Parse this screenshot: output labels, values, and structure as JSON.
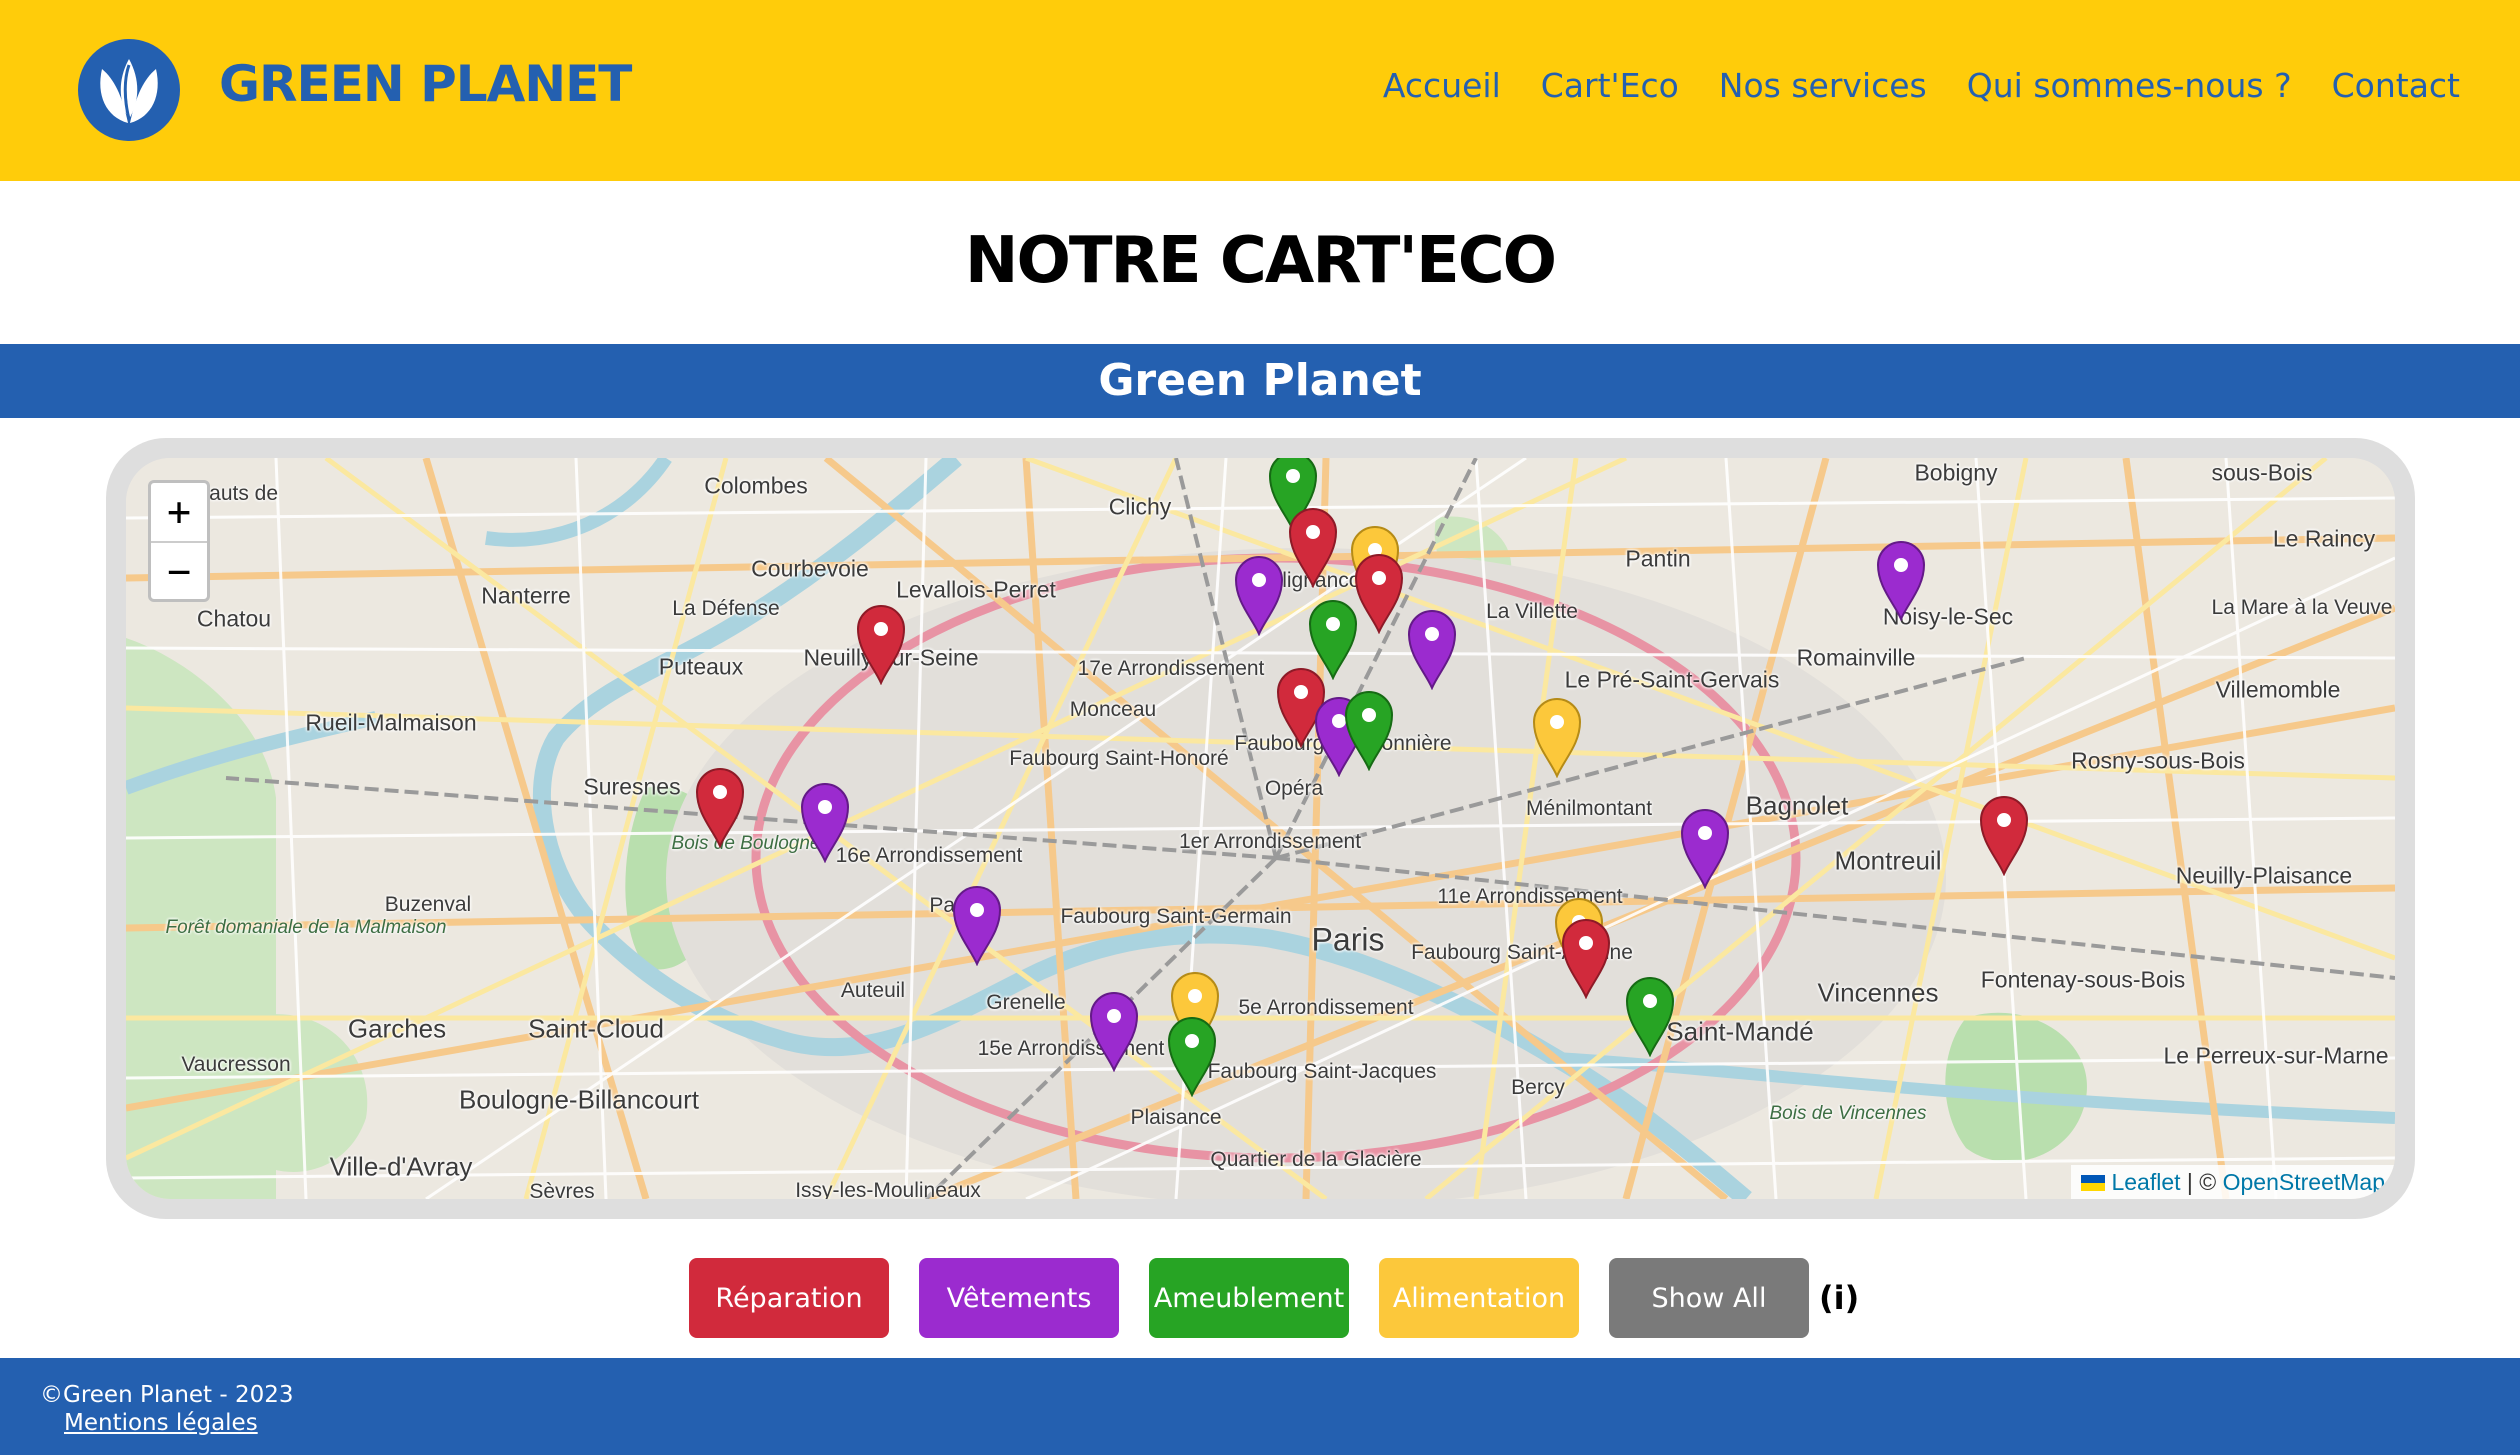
{
  "header": {
    "brand": "GREEN PLANET",
    "nav": [
      "Accueil",
      "Cart'Eco",
      "Nos services",
      "Qui sommes-nous ?",
      "Contact"
    ],
    "logo_icon": "leaf-logo-icon"
  },
  "page_title": "NOTRE CART'ECO",
  "band_title": "Green Planet",
  "map": {
    "zoom_in": "+",
    "zoom_out": "−",
    "attribution": {
      "leaflet": "Leaflet",
      "separator": " | © ",
      "osm": "OpenStreetMap"
    },
    "places": [
      "Hauts de",
      "Chatou",
      "Colombes",
      "Clichy",
      "Bobigny",
      "sous-Bois",
      "Le Raincy",
      "Nanterre",
      "Courbevoie",
      "La Défense",
      "Levallois-Perret",
      "Clignancourt",
      "Pantin",
      "La Villette",
      "Noisy-le-Sec",
      "La Mare à la Veuve",
      "Rueil-Malmaison",
      "Puteaux",
      "Neuilly-sur-Seine",
      "17e Arrondissement",
      "Monceau",
      "Le Pré-Saint-Gervais",
      "Romainville",
      "Villemomble",
      "Suresnes",
      "Faubourg Saint-Honoré",
      "Faubourg Poissonnière",
      "Opéra",
      "Ménilmontant",
      "Bagnolet",
      "Rosny-sous-Bois",
      "Bois de Boulogne",
      "16e Arrondissement",
      "1er Arrondissement",
      "Montreuil",
      "Neuilly-Plaisance",
      "Buzenval",
      "Forêt domaniale de la Malmaison",
      "Passy",
      "Faubourg Saint-Germain",
      "Paris",
      "11e Arrondissement",
      "Faubourg Saint-Antoine",
      "Fontenay-sous-Bois",
      "Garches",
      "Saint-Cloud",
      "Auteuil",
      "Grenelle",
      "15e Arrondissement",
      "5e Arrondissement",
      "Saint-Mandé",
      "Vincennes",
      "Le Perreux-sur-Marne",
      "Vaucresson",
      "Boulogne-Billancourt",
      "Faubourg Saint-Jacques",
      "Bercy",
      "Bois de Vincennes",
      "Ville-d'Avray",
      "Plaisance",
      "Quartier de la Glacière",
      "Sèvres",
      "Issy-les-Moulineaux"
    ],
    "marker_colors": {
      "reparation": "#D12A3C",
      "vetements": "#9B2BCF",
      "ameublement": "#27A424",
      "alimentation": "#FCC83B"
    },
    "markers": [
      {
        "category": "ameublement"
      },
      {
        "category": "reparation"
      },
      {
        "category": "alimentation"
      },
      {
        "category": "vetements"
      },
      {
        "category": "reparation"
      },
      {
        "category": "ameublement"
      },
      {
        "category": "vetements"
      },
      {
        "category": "reparation"
      },
      {
        "category": "vetements"
      },
      {
        "category": "reparation"
      },
      {
        "category": "vetements"
      },
      {
        "category": "ameublement"
      },
      {
        "category": "alimentation"
      },
      {
        "category": "reparation"
      },
      {
        "category": "vetements"
      },
      {
        "category": "vetements"
      },
      {
        "category": "reparation"
      },
      {
        "category": "vetements"
      },
      {
        "category": "alimentation"
      },
      {
        "category": "reparation"
      },
      {
        "category": "vetements"
      },
      {
        "category": "alimentation"
      },
      {
        "category": "ameublement"
      },
      {
        "category": "ameublement"
      }
    ]
  },
  "filters": [
    {
      "label": "Réparation",
      "color": "#D12A3C",
      "text_color": "#ffffff"
    },
    {
      "label": "Vêtements",
      "color": "#9B2BCF",
      "text_color": "#ffffff"
    },
    {
      "label": "Ameublement",
      "color": "#27A424",
      "text_color": "#ffffff"
    },
    {
      "label": "Alimentation",
      "color": "#FCC83B",
      "text_color": "#ffffff"
    },
    {
      "label": "Show All",
      "color": "#7A7A7A",
      "text_color": "#ffffff"
    }
  ],
  "info_label": "(i)",
  "footer": {
    "copyright": "©Green Planet - 2023",
    "legal": "Mentions légales"
  }
}
